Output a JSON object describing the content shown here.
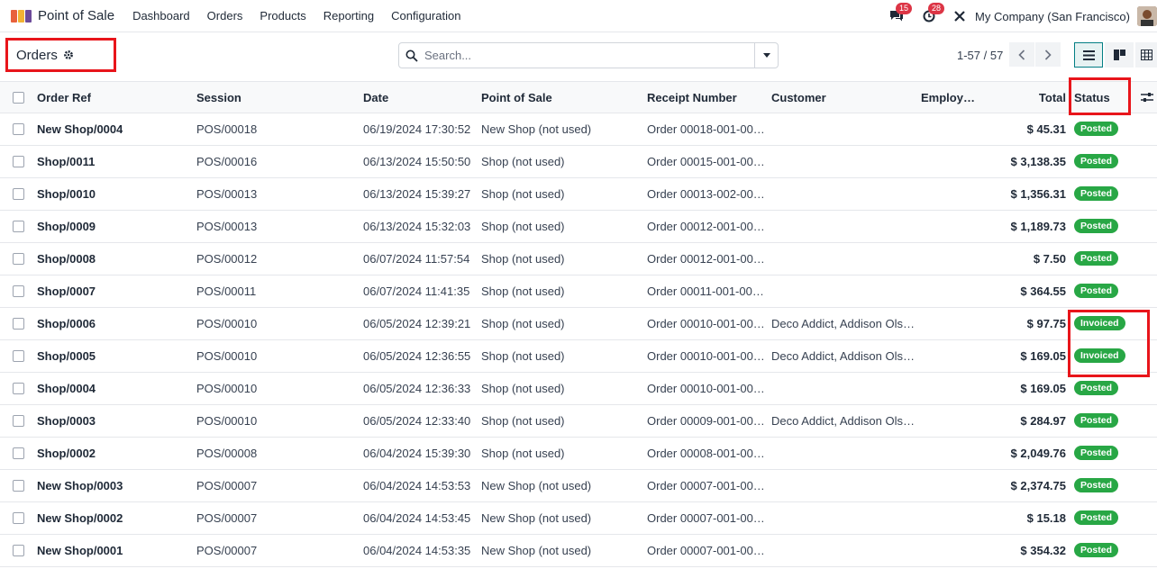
{
  "navbar": {
    "app_name": "Point of Sale",
    "menu": [
      "Dashboard",
      "Orders",
      "Products",
      "Reporting",
      "Configuration"
    ],
    "messages_count": "15",
    "activities_count": "28",
    "company": "My Company (San Francisco)"
  },
  "control": {
    "title": "Orders",
    "search_placeholder": "Search...",
    "pager": "1-57 / 57"
  },
  "columns": {
    "ref": "Order Ref",
    "session": "Session",
    "date": "Date",
    "pos": "Point of Sale",
    "receipt": "Receipt Number",
    "customer": "Customer",
    "employee": "Employ…",
    "total": "Total",
    "status": "Status"
  },
  "rows": [
    {
      "ref": "New Shop/0004",
      "session": "POS/00018",
      "date": "06/19/2024 17:30:52",
      "pos": "New Shop (not used)",
      "receipt": "Order 00018-001-00…",
      "customer": "",
      "total": "$ 45.31",
      "status": "Posted"
    },
    {
      "ref": "Shop/0011",
      "session": "POS/00016",
      "date": "06/13/2024 15:50:50",
      "pos": "Shop (not used)",
      "receipt": "Order 00015-001-00…",
      "customer": "",
      "total": "$ 3,138.35",
      "status": "Posted"
    },
    {
      "ref": "Shop/0010",
      "session": "POS/00013",
      "date": "06/13/2024 15:39:27",
      "pos": "Shop (not used)",
      "receipt": "Order 00013-002-00…",
      "customer": "",
      "total": "$ 1,356.31",
      "status": "Posted"
    },
    {
      "ref": "Shop/0009",
      "session": "POS/00013",
      "date": "06/13/2024 15:32:03",
      "pos": "Shop (not used)",
      "receipt": "Order 00012-001-00…",
      "customer": "",
      "total": "$ 1,189.73",
      "status": "Posted"
    },
    {
      "ref": "Shop/0008",
      "session": "POS/00012",
      "date": "06/07/2024 11:57:54",
      "pos": "Shop (not used)",
      "receipt": "Order 00012-001-00…",
      "customer": "",
      "total": "$ 7.50",
      "status": "Posted"
    },
    {
      "ref": "Shop/0007",
      "session": "POS/00011",
      "date": "06/07/2024 11:41:35",
      "pos": "Shop (not used)",
      "receipt": "Order 00011-001-00…",
      "customer": "",
      "total": "$ 364.55",
      "status": "Posted"
    },
    {
      "ref": "Shop/0006",
      "session": "POS/00010",
      "date": "06/05/2024 12:39:21",
      "pos": "Shop (not used)",
      "receipt": "Order 00010-001-00…",
      "customer": "Deco Addict, Addison Ols…",
      "total": "$ 97.75",
      "status": "Invoiced"
    },
    {
      "ref": "Shop/0005",
      "session": "POS/00010",
      "date": "06/05/2024 12:36:55",
      "pos": "Shop (not used)",
      "receipt": "Order 00010-001-00…",
      "customer": "Deco Addict, Addison Ols…",
      "total": "$ 169.05",
      "status": "Invoiced"
    },
    {
      "ref": "Shop/0004",
      "session": "POS/00010",
      "date": "06/05/2024 12:36:33",
      "pos": "Shop (not used)",
      "receipt": "Order 00010-001-00…",
      "customer": "",
      "total": "$ 169.05",
      "status": "Posted"
    },
    {
      "ref": "Shop/0003",
      "session": "POS/00010",
      "date": "06/05/2024 12:33:40",
      "pos": "Shop (not used)",
      "receipt": "Order 00009-001-00…",
      "customer": "Deco Addict, Addison Ols…",
      "total": "$ 284.97",
      "status": "Posted"
    },
    {
      "ref": "Shop/0002",
      "session": "POS/00008",
      "date": "06/04/2024 15:39:30",
      "pos": "Shop (not used)",
      "receipt": "Order 00008-001-00…",
      "customer": "",
      "total": "$ 2,049.76",
      "status": "Posted"
    },
    {
      "ref": "New Shop/0003",
      "session": "POS/00007",
      "date": "06/04/2024 14:53:53",
      "pos": "New Shop (not used)",
      "receipt": "Order 00007-001-00…",
      "customer": "",
      "total": "$ 2,374.75",
      "status": "Posted"
    },
    {
      "ref": "New Shop/0002",
      "session": "POS/00007",
      "date": "06/04/2024 14:53:45",
      "pos": "New Shop (not used)",
      "receipt": "Order 00007-001-00…",
      "customer": "",
      "total": "$ 15.18",
      "status": "Posted"
    },
    {
      "ref": "New Shop/0001",
      "session": "POS/00007",
      "date": "06/04/2024 14:53:35",
      "pos": "New Shop (not used)",
      "receipt": "Order 00007-001-00…",
      "customer": "",
      "total": "$ 354.32",
      "status": "Posted"
    }
  ],
  "colors": {
    "accent": "#017e84",
    "status_green": "#28a745",
    "highlight": "#e8151b",
    "badge_red": "#dc3545"
  }
}
